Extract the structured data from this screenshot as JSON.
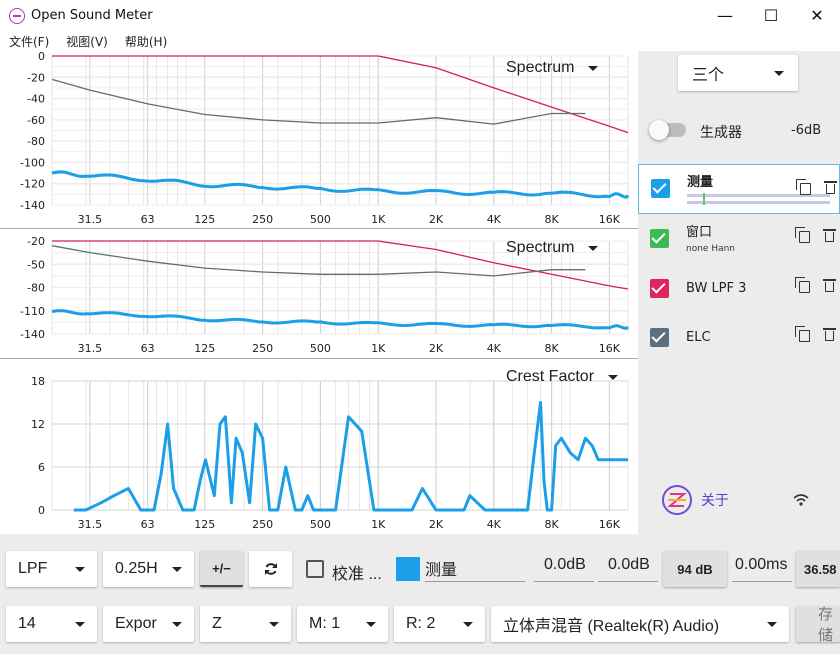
{
  "window": {
    "title": "Open Sound Meter",
    "minimize": "—",
    "maximize": "☐",
    "close": "✕"
  },
  "menu": [
    "文件(F)",
    "视图(V)",
    "帮助(H)"
  ],
  "plots": [
    {
      "type": "Spectrum",
      "yticks": [
        "0",
        "-20",
        "-40",
        "-60",
        "-80",
        "-100",
        "-120",
        "-140"
      ]
    },
    {
      "type": "Spectrum",
      "yticks": [
        "-20",
        "-50",
        "-80",
        "-110",
        "-140"
      ]
    },
    {
      "type": "Crest Factor",
      "yticks": [
        "18",
        "12",
        "6",
        "0"
      ]
    }
  ],
  "xticks": [
    "31.5",
    "63",
    "125",
    "250",
    "500",
    "1K",
    "2K",
    "4K",
    "8K",
    "16K"
  ],
  "sidebar": {
    "layout_select": "三个",
    "generator": {
      "label": "生成器",
      "level": "-6dB",
      "on": false
    },
    "sources": [
      {
        "name": "测量",
        "sub": "",
        "color": "#1a9fe8",
        "selected": true
      },
      {
        "name": "窗口",
        "sub": "none Hann",
        "color": "#3cba54"
      },
      {
        "name": "BW LPF 3",
        "sub": "",
        "color": "#e0245e"
      },
      {
        "name": "ELC",
        "sub": "",
        "color": "#5b6e7e"
      }
    ],
    "about": "关于"
  },
  "toolbar1": {
    "filter": "LPF",
    "speed": "0.25H",
    "polarity": "+/−",
    "calibrate": "校准 ...",
    "source_color": "#1a9fe8",
    "source_name": "测量",
    "gain1": "0.0dB",
    "gain2": "0.0dB",
    "spl": "94 dB",
    "delay": "0.00ms",
    "extra": "36.58"
  },
  "toolbar2": {
    "fft": "14",
    "mode": "Expor",
    "weighting": "Z",
    "m_channel": "M: 1",
    "r_channel": "R: 2",
    "device": "立体声混音 (Realtek(R) Audio)",
    "save": "存储"
  },
  "colors": {
    "measure": "#1a9fe8",
    "lpf": "#d81b60",
    "elc": "#5b6e7e"
  },
  "chart_data": [
    {
      "type": "line",
      "title": "Spectrum",
      "xlabel": "",
      "ylabel": "",
      "x_scale": "log",
      "xticks": [
        31.5,
        63,
        125,
        250,
        500,
        1000,
        2000,
        4000,
        8000,
        16000
      ],
      "xlim": [
        20,
        20000
      ],
      "ylim": [
        -140,
        0
      ],
      "series": [
        {
          "name": "BW LPF 3",
          "color": "#d81b60",
          "x": [
            20,
            500,
            1000,
            2000,
            4000,
            8000,
            16000,
            20000
          ],
          "y": [
            0,
            0,
            0,
            -11,
            -30,
            -48,
            -66,
            -72
          ]
        },
        {
          "name": "ELC",
          "color": "#5b6e7e",
          "x": [
            20,
            31.5,
            63,
            125,
            250,
            500,
            1000,
            2000,
            4000,
            8000,
            12000
          ],
          "y": [
            -22,
            -32,
            -45,
            -55,
            -60,
            -63,
            -63,
            -58,
            -64,
            -54,
            -54
          ]
        },
        {
          "name": "测量",
          "color": "#1a9fe8",
          "x": [
            20,
            31.5,
            63,
            125,
            250,
            500,
            1000,
            2000,
            4000,
            8000,
            16000,
            20000
          ],
          "y": [
            -110,
            -112,
            -116,
            -121,
            -123,
            -125,
            -127,
            -128,
            -129,
            -129,
            -131,
            -131
          ]
        }
      ]
    },
    {
      "type": "line",
      "title": "Spectrum",
      "xlabel": "",
      "ylabel": "",
      "x_scale": "log",
      "xticks": [
        31.5,
        63,
        125,
        250,
        500,
        1000,
        2000,
        4000,
        8000,
        16000
      ],
      "xlim": [
        20,
        20000
      ],
      "ylim": [
        -140,
        -20
      ],
      "series": [
        {
          "name": "BW LPF 3",
          "color": "#d81b60",
          "x": [
            20,
            500,
            1000,
            2000,
            4000,
            8000,
            16000,
            20000
          ],
          "y": [
            -20,
            -20,
            -20,
            -31,
            -48,
            -63,
            -78,
            -82
          ]
        },
        {
          "name": "ELC",
          "color": "#5b6e7e",
          "x": [
            20,
            31.5,
            63,
            125,
            250,
            500,
            1000,
            2000,
            4000,
            8000,
            12000
          ],
          "y": [
            -26,
            -35,
            -46,
            -55,
            -60,
            -63,
            -63,
            -60,
            -65,
            -57,
            -57
          ]
        },
        {
          "name": "测量",
          "color": "#1a9fe8",
          "x": [
            20,
            31.5,
            63,
            125,
            250,
            500,
            1000,
            2000,
            4000,
            8000,
            16000,
            20000
          ],
          "y": [
            -111,
            -113,
            -116,
            -121,
            -124,
            -125,
            -127,
            -128,
            -129,
            -129,
            -131,
            -131
          ]
        }
      ]
    },
    {
      "type": "line",
      "title": "Crest Factor",
      "xlabel": "",
      "ylabel": "",
      "x_scale": "log",
      "xticks": [
        31.5,
        63,
        125,
        250,
        500,
        1000,
        2000,
        4000,
        8000,
        16000
      ],
      "xlim": [
        20,
        20000
      ],
      "ylim": [
        0,
        18
      ],
      "series": [
        {
          "name": "测量",
          "color": "#1a9fe8",
          "x": [
            26,
            30,
            36,
            42,
            50,
            58,
            68,
            74,
            80,
            86,
            96,
            110,
            118,
            126,
            140,
            150,
            160,
            172,
            182,
            196,
            214,
            230,
            250,
            272,
            300,
            330,
            370,
            400,
            430,
            460,
            490,
            540,
            600,
            700,
            820,
            950,
            1100,
            1200,
            1300,
            1400,
            1500,
            1700,
            2000,
            2600,
            2800,
            3000,
            3600,
            3900,
            4100,
            4500,
            4900,
            5200,
            5500,
            6000,
            6500,
            7000,
            7300,
            7600,
            8000,
            8400,
            9000,
            10000,
            11000,
            12000,
            13000,
            14000,
            15000,
            16000,
            18000,
            20000
          ],
          "y": [
            0,
            0,
            1,
            2,
            3,
            0,
            0,
            5,
            12,
            3,
            0,
            0,
            4,
            7,
            2,
            12,
            13,
            1,
            10,
            8,
            1,
            12,
            10,
            0,
            0,
            6,
            0,
            0,
            2,
            0,
            0,
            0,
            0,
            13,
            11,
            0,
            0,
            0,
            0,
            0,
            0,
            3,
            0,
            0,
            0,
            2,
            0,
            0,
            0,
            0,
            0,
            0,
            0,
            0,
            8,
            15,
            4,
            0,
            0,
            9,
            10,
            8,
            7,
            10,
            9,
            7,
            7,
            7,
            7,
            7
          ]
        }
      ]
    }
  ]
}
